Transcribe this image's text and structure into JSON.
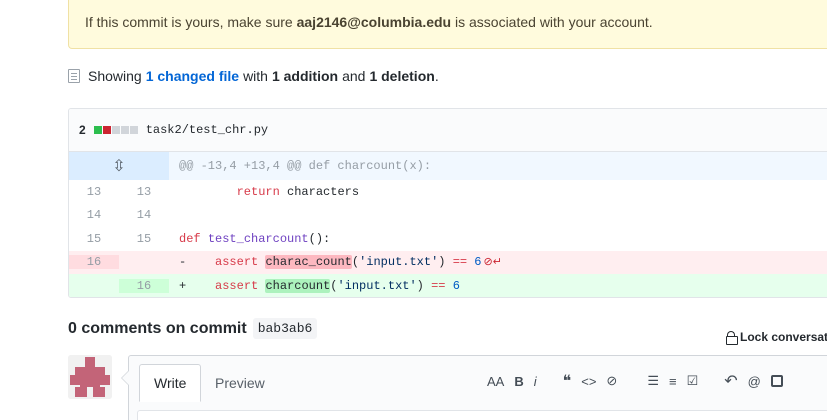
{
  "flash": {
    "prefix": "If this commit is yours, make sure",
    "email": "aaj2146@columbia.edu",
    "suffix": "is associated with your account."
  },
  "summary": {
    "showing": "Showing",
    "changed": "1 changed file",
    "with": "with",
    "additions": "1 addition",
    "and": "and",
    "deletions": "1 deletion",
    "period": "."
  },
  "diff": {
    "count": "2",
    "file": "task2/test_chr.py",
    "hunk": "@@ -13,4 +13,4 @@ def charcount(x):",
    "lines": [
      {
        "old": "13",
        "new": "13"
      },
      {
        "old": "14",
        "new": "14"
      },
      {
        "old": "15",
        "new": "15"
      },
      {
        "old": "16",
        "new": ""
      },
      {
        "old": "",
        "new": "16"
      }
    ],
    "code": {
      "return_kw": "return",
      "return_rest": " characters",
      "def_kw": "def",
      "def_name": "test_charcount",
      "def_rest": "():",
      "del_sign": "-",
      "add_sign": "+",
      "assert_kw": "assert",
      "del_fn": "charac_count",
      "add_fn": "charcount",
      "arg_open": "(",
      "arg_str": "'input.txt'",
      "arg_close": ")",
      "eq": "==",
      "val": "6"
    }
  },
  "comments": {
    "title": "0 comments on commit",
    "sha": "bab3ab6",
    "lock": "Lock conversation"
  },
  "editor": {
    "tab_write": "Write",
    "tab_preview": "Preview",
    "toolbar": {
      "header": "AA",
      "bold": "B",
      "italic": "i",
      "quote": "❝",
      "code": "<>",
      "link": "⊘",
      "ul": "☰",
      "ol": "≡",
      "task": "☑",
      "reply": "↶",
      "mention": "@"
    }
  }
}
